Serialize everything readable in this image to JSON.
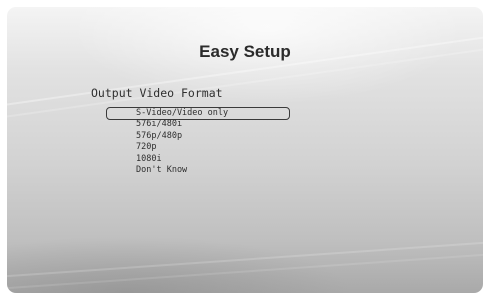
{
  "screen": {
    "title": "Easy Setup",
    "section_label": "Output Video Format"
  },
  "options": [
    {
      "label": "S-Video/Video only",
      "selected": true
    },
    {
      "label": "576i/480i",
      "selected": false
    },
    {
      "label": "576p/480p",
      "selected": false
    },
    {
      "label": "720p",
      "selected": false
    },
    {
      "label": "1080i",
      "selected": false
    },
    {
      "label": "Don't Know",
      "selected": false
    }
  ],
  "colors": {
    "text": "#2f2f2f",
    "title": "#2b2b2b",
    "highlight_border": "#3a3a3a"
  }
}
